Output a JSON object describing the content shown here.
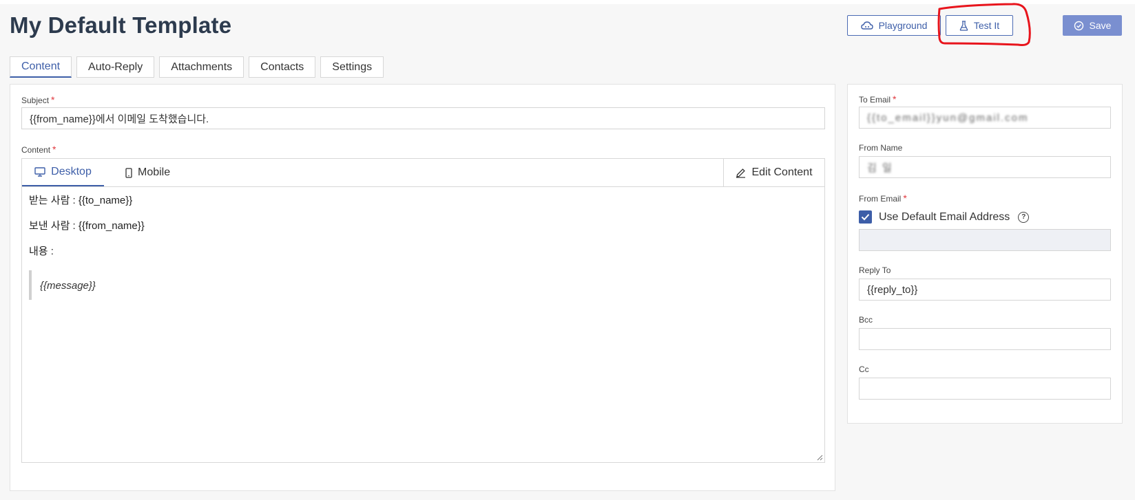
{
  "header": {
    "title": "My Default Template",
    "buttons": {
      "playground": "Playground",
      "test_it": "Test It",
      "save": "Save"
    }
  },
  "tabs": [
    {
      "label": "Content",
      "active": true
    },
    {
      "label": "Auto-Reply",
      "active": false
    },
    {
      "label": "Attachments",
      "active": false
    },
    {
      "label": "Contacts",
      "active": false
    },
    {
      "label": "Settings",
      "active": false
    }
  ],
  "content": {
    "subject_label": "Subject",
    "subject_value": "{{from_name}}에서 이메일 도착했습니다.",
    "content_label": "Content",
    "editor_tabs": {
      "desktop": "Desktop",
      "mobile": "Mobile",
      "edit": "Edit Content"
    },
    "body_lines": [
      "받는 사람 : {{to_name}}",
      "보낸 사람 : {{from_name}}",
      "내용 :"
    ],
    "quote": "{{message}}"
  },
  "side": {
    "to_email_label": "To Email",
    "to_email_value": "{{to_email}}yun@gmail.com",
    "from_name_label": "From Name",
    "from_name_value": "김 일",
    "from_email_label": "From Email",
    "use_default_label": "Use Default Email Address",
    "use_default_checked": true,
    "from_email_value": "",
    "reply_to_label": "Reply To",
    "reply_to_value": "{{reply_to}}",
    "bcc_label": "Bcc",
    "bcc_value": "",
    "cc_label": "Cc",
    "cc_value": ""
  },
  "colors": {
    "accent": "#3d5ea8",
    "save_bg": "#7a8fd0",
    "required": "#e0383e",
    "annotation": "#e8141c"
  },
  "icons": {
    "playground": "cloud-gamepad-icon",
    "test_it": "flask-icon",
    "save": "check-circle-icon",
    "desktop": "monitor-icon",
    "mobile": "phone-icon",
    "edit": "pencil-icon",
    "help": "question-circle-icon"
  }
}
